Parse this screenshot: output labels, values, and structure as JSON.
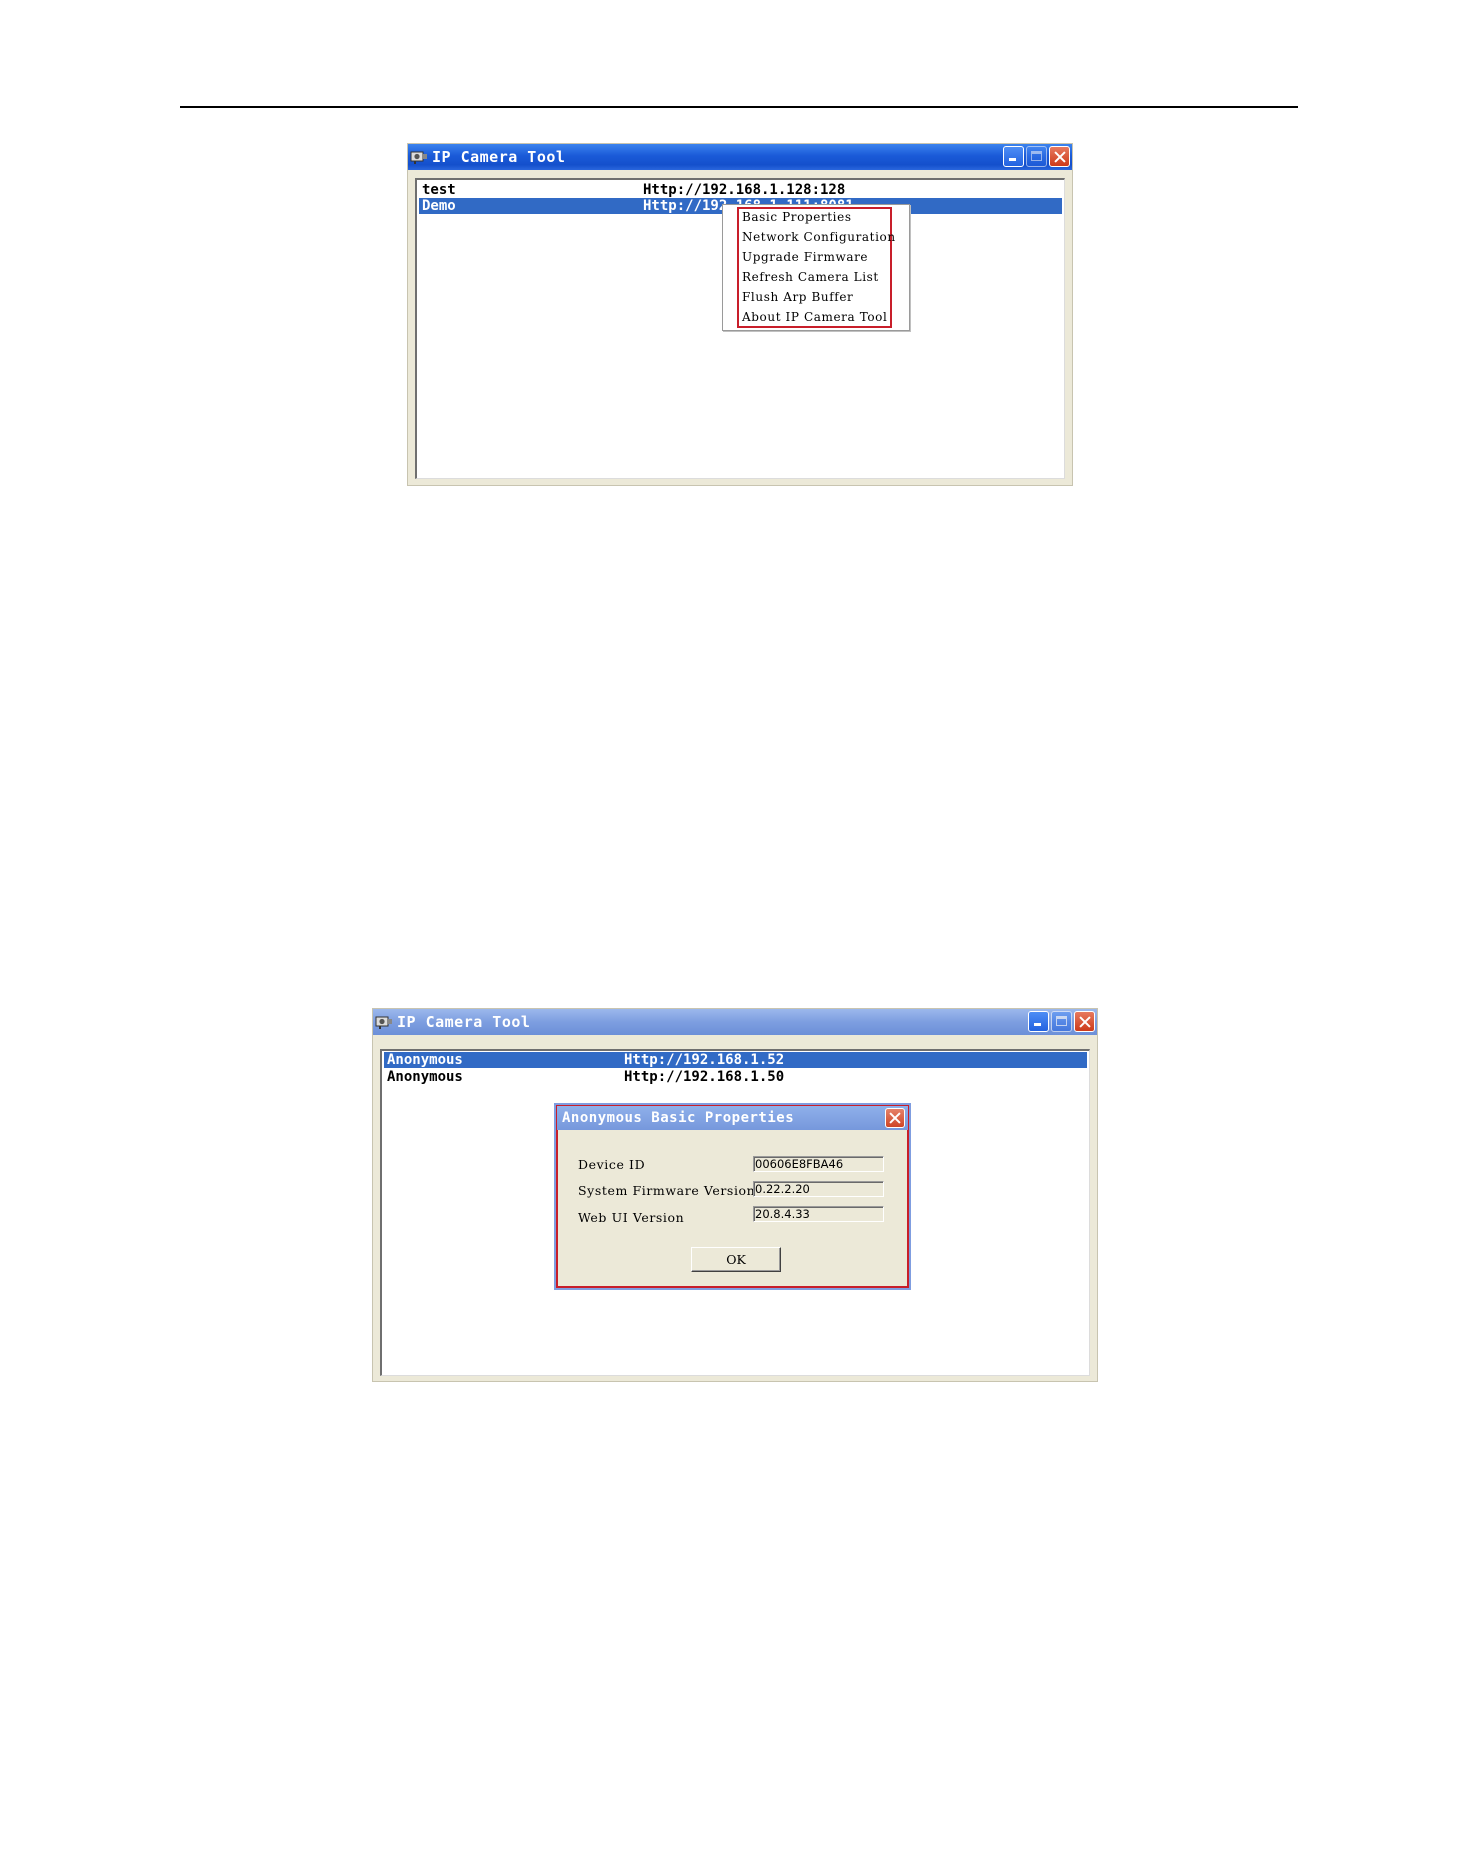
{
  "window1": {
    "title": "IP Camera Tool",
    "rows": [
      {
        "name": "test",
        "url": "Http://192.168.1.128:128"
      },
      {
        "name": "Demo",
        "url": "Http://192.168.1.111:8081"
      }
    ],
    "context_menu": [
      "Basic Properties",
      "Network Configuration",
      "Upgrade Firmware",
      "Refresh Camera List",
      "Flush Arp Buffer",
      "About IP Camera Tool"
    ]
  },
  "window2": {
    "title": "IP Camera Tool",
    "rows": [
      {
        "name": "Anonymous",
        "url": "Http://192.168.1.52"
      },
      {
        "name": "Anonymous",
        "url": "Http://192.168.1.50"
      }
    ],
    "dialog": {
      "title": "Anonymous Basic Properties",
      "fields": [
        {
          "label": "Device ID",
          "value": "00606E8FBA46"
        },
        {
          "label": "System Firmware Version",
          "value": "0.22.2.20"
        },
        {
          "label": "Web UI Version",
          "value": "20.8.4.33"
        }
      ],
      "ok_label": "OK"
    }
  },
  "colors": {
    "selection": "#316ac5",
    "highlight_frame": "#c81e2a",
    "window_face": "#ece9d8"
  }
}
